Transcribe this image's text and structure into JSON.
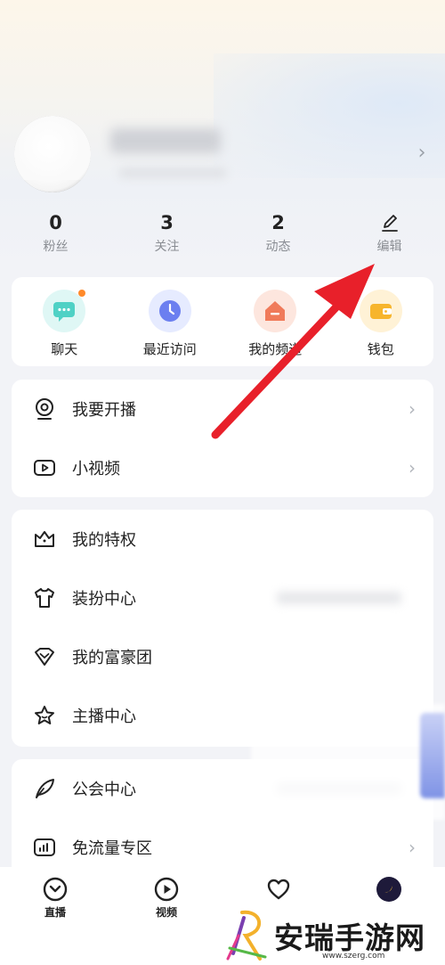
{
  "profile": {
    "chevron": "›"
  },
  "stats": [
    {
      "num": "0",
      "label": "粉丝"
    },
    {
      "num": "3",
      "label": "关注"
    },
    {
      "num": "2",
      "label": "动态"
    },
    {
      "icon": "edit-icon",
      "label": "编辑"
    }
  ],
  "shortcuts": [
    {
      "label": "聊天",
      "icon": "chat-icon",
      "color": "#4fd1c5"
    },
    {
      "label": "最近访问",
      "icon": "clock-icon",
      "color": "#6b7ff0"
    },
    {
      "label": "我的频道",
      "icon": "channel-icon",
      "color": "#f07a5a"
    },
    {
      "label": "钱包",
      "icon": "wallet-icon",
      "color": "#f7b52c"
    }
  ],
  "menu1": [
    {
      "label": "我要开播",
      "icon": "live-camera-icon"
    },
    {
      "label": "小视频",
      "icon": "video-play-icon"
    }
  ],
  "menu2": [
    {
      "label": "我的特权",
      "icon": "crown-icon"
    },
    {
      "label": "装扮中心",
      "icon": "tshirt-icon"
    },
    {
      "label": "我的富豪团",
      "icon": "diamond-icon"
    },
    {
      "label": "主播中心",
      "icon": "star-icon"
    }
  ],
  "menu3": [
    {
      "label": "公会中心",
      "icon": "feather-icon"
    },
    {
      "label": "免流量专区",
      "icon": "bar-chart-icon"
    }
  ],
  "tabbar": [
    {
      "label": "直播",
      "icon": "live-tab-icon"
    },
    {
      "label": "视频",
      "icon": "video-tab-icon"
    },
    {
      "label": "",
      "icon": "heart-icon"
    },
    {
      "label": "",
      "icon": "avatar-tab-icon"
    }
  ],
  "watermark": {
    "text": "安瑞手游网",
    "url": "www.szerg.com"
  },
  "colors": {
    "accent_arrow": "#e8202a",
    "dot": "#ff8a2a"
  }
}
